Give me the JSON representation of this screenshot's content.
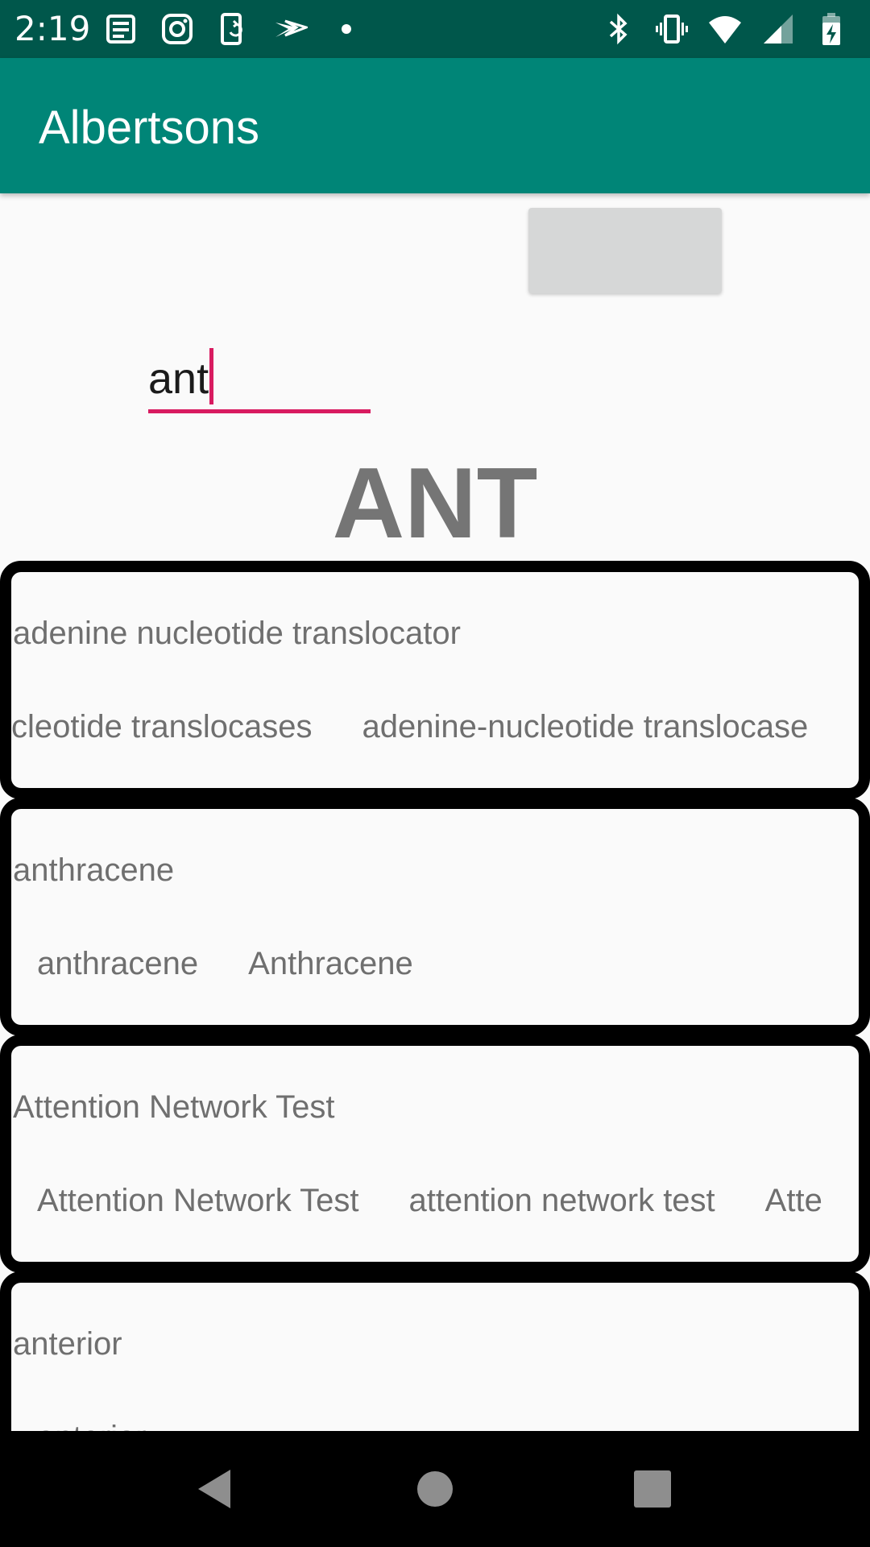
{
  "status_bar": {
    "time": "2:19",
    "left_icons": [
      "news-icon",
      "instagram-icon",
      "phone-sync-icon",
      "sprint-icon",
      "dot-icon"
    ],
    "right_icons": [
      "bluetooth-icon",
      "vibrate-icon",
      "wifi-icon",
      "signal-icon",
      "battery-charging-icon"
    ],
    "background": "#00574b"
  },
  "app_bar": {
    "title": "Albertsons",
    "background": "#008577"
  },
  "search": {
    "value": "ant",
    "accent": "#d81b60"
  },
  "heading": "ANT",
  "results": [
    {
      "title": "adenine nucleotide translocator",
      "variants": [
        "cleotide translocases",
        "adenine-nucleotide translocase"
      ]
    },
    {
      "title": "anthracene",
      "variants": [
        "anthracene",
        "Anthracene"
      ]
    },
    {
      "title": "Attention Network Test",
      "variants": [
        "Attention Network Test",
        "attention network test",
        "Atte"
      ]
    },
    {
      "title": "anterior",
      "variants": [
        "anterior"
      ]
    }
  ],
  "nav_bar": {
    "buttons": [
      "back-icon",
      "home-icon",
      "recents-icon"
    ]
  }
}
